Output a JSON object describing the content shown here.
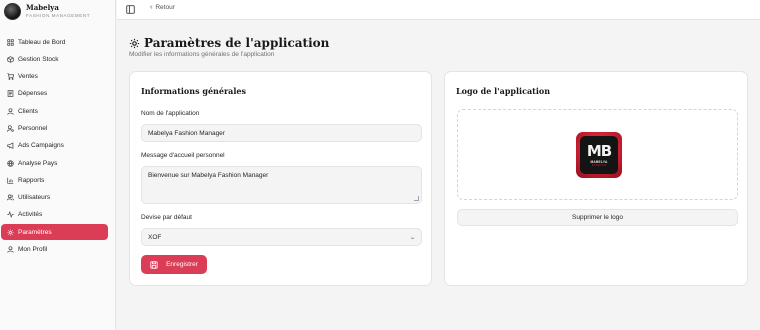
{
  "brand": {
    "name": "Mabelya",
    "subtitle": "FASHION MANAGEMENT"
  },
  "sidebar": {
    "items": [
      {
        "label": "Tableau de Bord",
        "icon": "grid-icon"
      },
      {
        "label": "Gestion Stock",
        "icon": "box-icon"
      },
      {
        "label": "Ventes",
        "icon": "cart-icon"
      },
      {
        "label": "Dépenses",
        "icon": "receipt-icon"
      },
      {
        "label": "Clients",
        "icon": "user-icon"
      },
      {
        "label": "Personnel",
        "icon": "user-cog-icon"
      },
      {
        "label": "Ads Campaigns",
        "icon": "megaphone-icon"
      },
      {
        "label": "Analyse Pays",
        "icon": "globe-icon"
      },
      {
        "label": "Rapports",
        "icon": "bar-chart-icon"
      },
      {
        "label": "Utilisateurs",
        "icon": "users-icon"
      },
      {
        "label": "Activités",
        "icon": "activity-icon"
      },
      {
        "label": "Paramètres",
        "icon": "gear-icon",
        "active": true
      },
      {
        "label": "Mon Profil",
        "icon": "user-icon"
      }
    ]
  },
  "topbar": {
    "back_label": "Retour"
  },
  "page": {
    "title": "Paramètres de l'application",
    "subtitle": "Modifier les informations générales de l'application"
  },
  "general": {
    "title": "Informations générales",
    "app_name_label": "Nom de l'application",
    "app_name_value": "Mabelya Fashion Manager",
    "welcome_label": "Message d'accueil personnel",
    "welcome_value": "Bienvenue sur Mabelya Fashion Manager",
    "currency_label": "Devise par défaut",
    "currency_value": "XOF",
    "save_label": "Enregistrer"
  },
  "logo_card": {
    "title": "Logo de l'application",
    "logo_mark": "MB",
    "logo_line1": "MABELYA",
    "logo_line2": "FASHION",
    "remove_label": "Supprimer le logo"
  },
  "colors": {
    "accent": "#dc3d56",
    "background": "#f4f4f5"
  }
}
